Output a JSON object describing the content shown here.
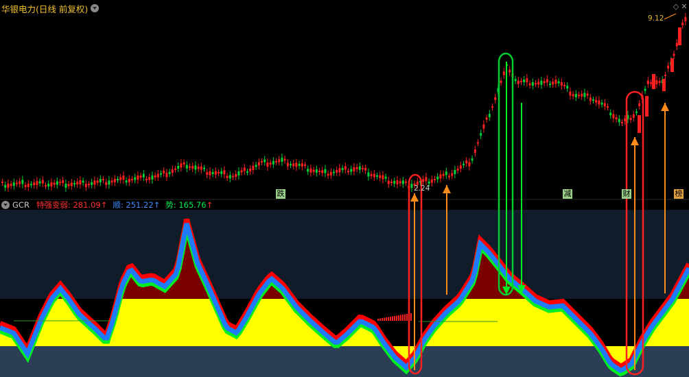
{
  "header": {
    "title": "华银电力(日线 前复权)"
  },
  "window": {
    "diamond_icon": "◇",
    "close_icon": "✕"
  },
  "main_chart": {
    "price_high_label": "9.12",
    "price_low_label": "2.24",
    "signals": [
      {
        "name": "signal-die",
        "text": "跌"
      },
      {
        "name": "signal-jian",
        "text": "减"
      },
      {
        "name": "signal-cai",
        "text": "财"
      },
      {
        "name": "signal-zhuan",
        "text": "榜"
      }
    ]
  },
  "indicator": {
    "name": "GCR",
    "line1_label": "特强变弱:",
    "line1_value": "281.09",
    "line2_label": "顺:",
    "line2_value": "251.22",
    "line3_label": "势:",
    "line3_value": "165.76",
    "arrow_up": "↑"
  },
  "colors": {
    "bg": "#000000",
    "upper_band": "#101c2a",
    "lower_band": "#2c3e55",
    "yellow": "#ffff00",
    "dark_red": "#7a0000",
    "bright_red": "#ff0000",
    "blue": "#1e7bff",
    "green": "#00ee22",
    "orange": "#ff8c1a",
    "red_candle": "#ff2020",
    "green_candle": "#00d23a"
  }
}
